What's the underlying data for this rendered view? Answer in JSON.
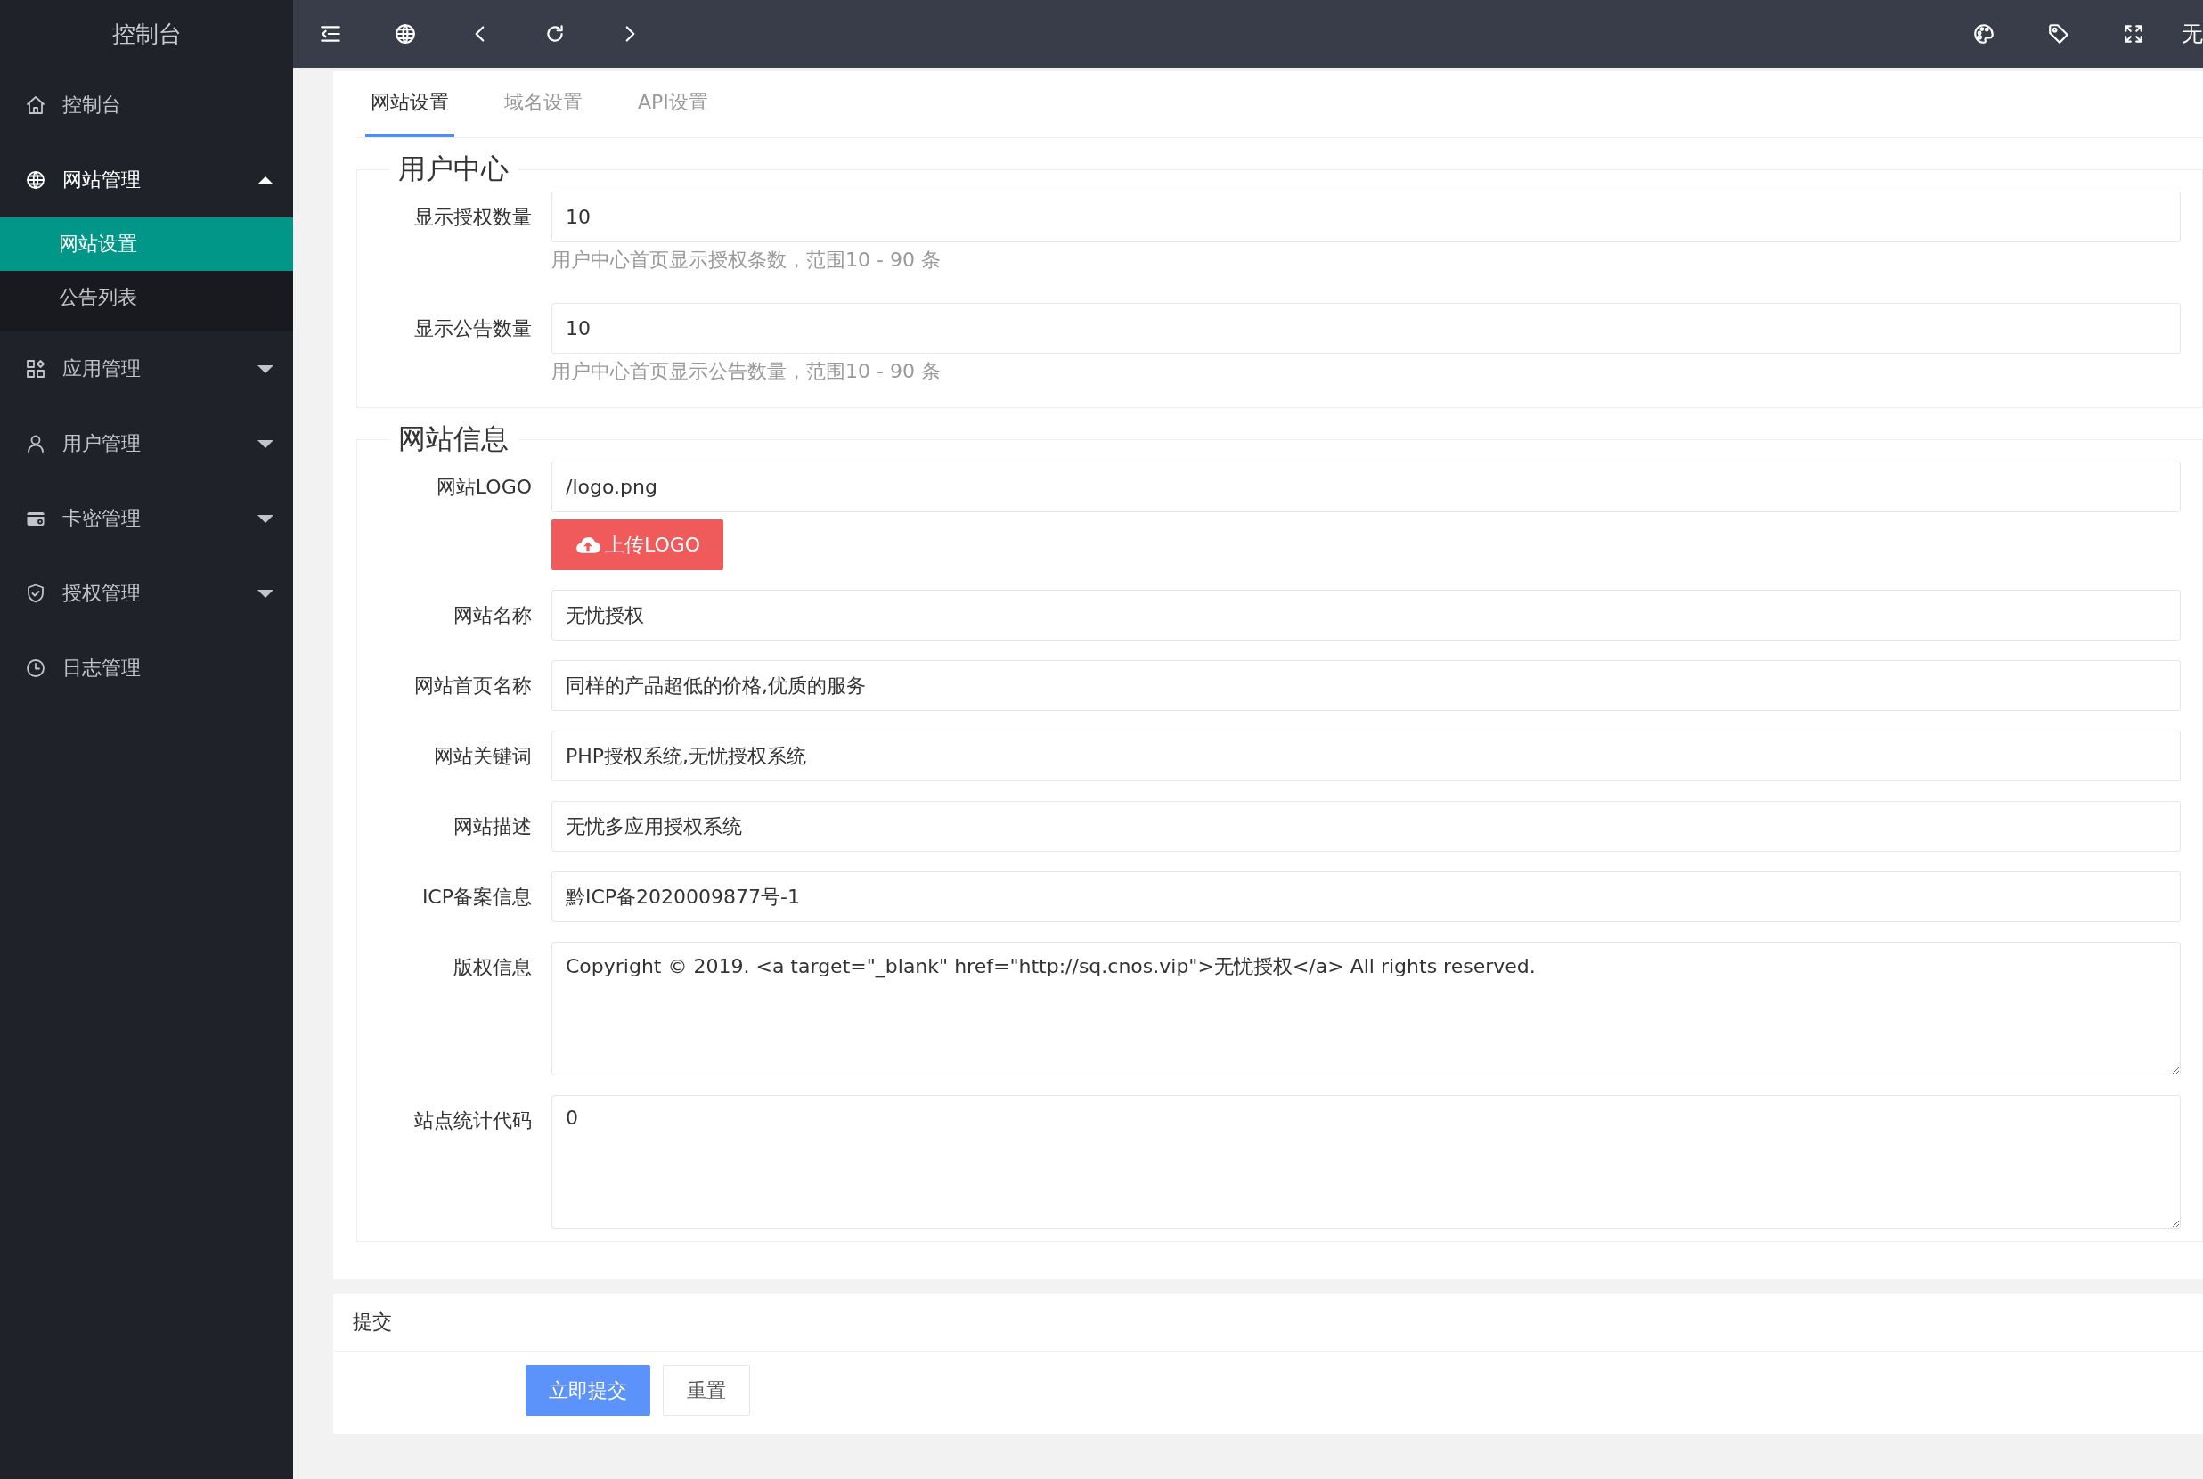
{
  "sidebar": {
    "title": "控制台",
    "items": [
      {
        "kind": "link",
        "label": "控制台"
      },
      {
        "kind": "group",
        "label": "网站管理",
        "expanded": true,
        "children": [
          {
            "label": "网站设置",
            "selected": true
          },
          {
            "label": "公告列表",
            "selected": false
          }
        ]
      },
      {
        "kind": "group",
        "label": "应用管理",
        "expanded": false
      },
      {
        "kind": "group",
        "label": "用户管理",
        "expanded": false
      },
      {
        "kind": "group",
        "label": "卡密管理",
        "expanded": false
      },
      {
        "kind": "group",
        "label": "授权管理",
        "expanded": false
      },
      {
        "kind": "link",
        "label": "日志管理"
      }
    ]
  },
  "header": {
    "user": "无"
  },
  "tabs": [
    {
      "label": "网站设置",
      "selected": true
    },
    {
      "label": "域名设置",
      "selected": false
    },
    {
      "label": "API设置",
      "selected": false
    }
  ],
  "fieldsets": [
    {
      "legend": "用户中心",
      "fields": [
        {
          "kind": "input",
          "label": "显示授权数量",
          "value": "10",
          "hint": "用户中心首页显示授权条数，范围10 - 90 条"
        },
        {
          "kind": "input",
          "label": "显示公告数量",
          "value": "10",
          "hint": "用户中心首页显示公告数量，范围10 - 90 条"
        }
      ]
    },
    {
      "legend": "网站信息",
      "fields": [
        {
          "kind": "input",
          "label": "网站LOGO",
          "value": "/logo.png",
          "button": "上传LOGO"
        },
        {
          "kind": "input",
          "label": "网站名称",
          "value": "无忧授权"
        },
        {
          "kind": "input",
          "label": "网站首页名称",
          "value": "同样的产品超低的价格,优质的服务"
        },
        {
          "kind": "input",
          "label": "网站关键词",
          "value": "PHP授权系统,无忧授权系统"
        },
        {
          "kind": "input",
          "label": "网站描述",
          "value": "无忧多应用授权系统"
        },
        {
          "kind": "input",
          "label": "ICP备案信息",
          "value": "黔ICP备2020009877号-1"
        },
        {
          "kind": "textarea",
          "label": "版权信息",
          "value": "Copyright © 2019. <a target=\"_blank\" href=\"http://sq.cnos.vip\">无忧授权</a> All rights reserved."
        },
        {
          "kind": "textarea",
          "label": "站点统计代码",
          "value": "0"
        }
      ]
    }
  ],
  "submit": {
    "title": "提交",
    "buttons": [
      {
        "label": "立即提交",
        "kind": "primary"
      },
      {
        "label": "重置",
        "kind": "default"
      }
    ]
  }
}
